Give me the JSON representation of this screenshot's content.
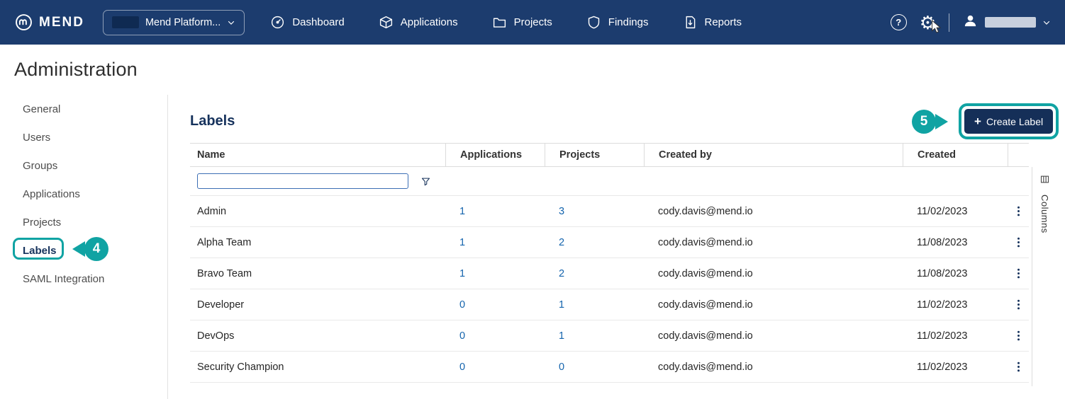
{
  "navbar": {
    "brand": "MEND",
    "org_dropdown": {
      "label": "Mend Platform..."
    },
    "items": [
      {
        "label": "Dashboard",
        "icon": "dashboard-icon"
      },
      {
        "label": "Applications",
        "icon": "applications-icon"
      },
      {
        "label": "Projects",
        "icon": "projects-icon"
      },
      {
        "label": "Findings",
        "icon": "findings-icon"
      },
      {
        "label": "Reports",
        "icon": "reports-icon"
      }
    ]
  },
  "icons": {
    "help_glyph": "?",
    "gear_glyph": "⚙"
  },
  "page": {
    "title": "Administration"
  },
  "sidebar": {
    "items": [
      {
        "label": "General"
      },
      {
        "label": "Users"
      },
      {
        "label": "Groups"
      },
      {
        "label": "Applications"
      },
      {
        "label": "Projects"
      },
      {
        "label": "Labels",
        "selected": true
      },
      {
        "label": "SAML Integration"
      }
    ]
  },
  "labels_page": {
    "heading": "Labels",
    "create_button": {
      "plus": "+",
      "label": "Create Label"
    },
    "columns_strip": "Columns",
    "table": {
      "headers": [
        "Name",
        "Applications",
        "Projects",
        "Created by",
        "Created"
      ],
      "rows": [
        {
          "name": "Admin",
          "applications": "1",
          "projects": "3",
          "created_by": "cody.davis@mend.io",
          "created": "11/02/2023"
        },
        {
          "name": "Alpha Team",
          "applications": "1",
          "projects": "2",
          "created_by": "cody.davis@mend.io",
          "created": "11/08/2023"
        },
        {
          "name": "Bravo Team",
          "applications": "1",
          "projects": "2",
          "created_by": "cody.davis@mend.io",
          "created": "11/08/2023"
        },
        {
          "name": "Developer",
          "applications": "0",
          "projects": "1",
          "created_by": "cody.davis@mend.io",
          "created": "11/02/2023"
        },
        {
          "name": "DevOps",
          "applications": "0",
          "projects": "1",
          "created_by": "cody.davis@mend.io",
          "created": "11/02/2023"
        },
        {
          "name": "Security Champion",
          "applications": "0",
          "projects": "0",
          "created_by": "cody.davis@mend.io",
          "created": "11/02/2023"
        }
      ]
    }
  },
  "annotations": {
    "step4": "4",
    "step5": "5",
    "accent_color": "#10a3a3"
  }
}
